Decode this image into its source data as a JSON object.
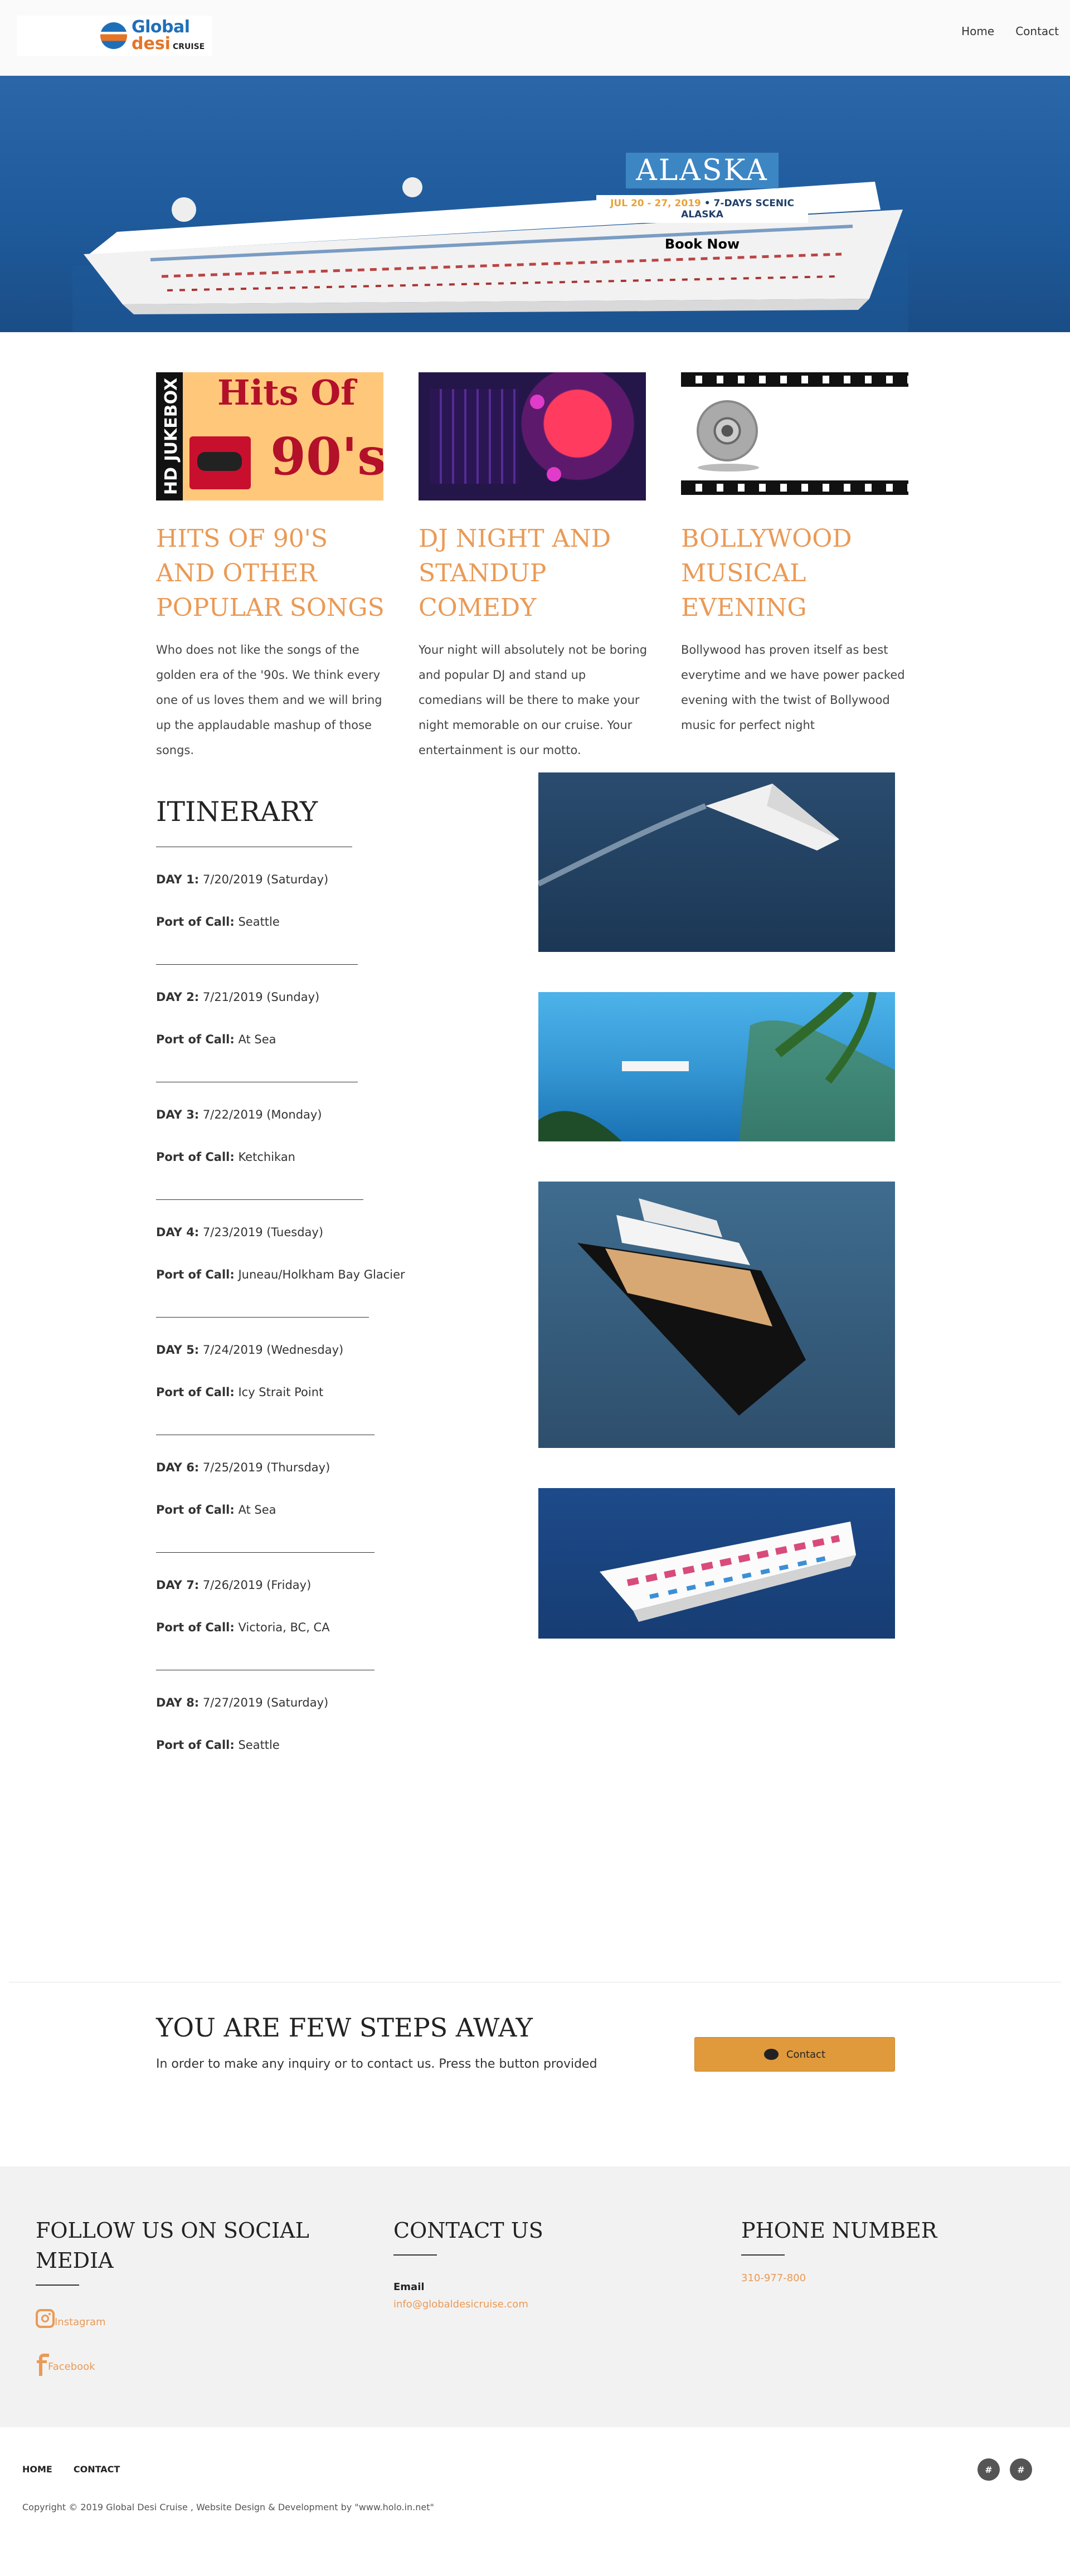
{
  "header": {
    "logo": {
      "global": "Global",
      "desi": "desi",
      "cruise": "CRUISE"
    },
    "nav": [
      "Home",
      "Contact"
    ]
  },
  "hero": {
    "title": "ALASKA",
    "dates": "JUL 20 - 27, 2019",
    "dates_extra": " • 7-DAYS SCENIC ALASKA",
    "book_label": "Book Now"
  },
  "features": [
    {
      "title": "HITS OF 90'S AND OTHER POPULAR SONGS",
      "text": "Who does not like the songs of the golden era of the '90s. We think every one of us loves them and we will bring up the applaudable mashup of those songs.",
      "image": {
        "side": "HD JUKEBOX",
        "top": "Hits Of",
        "big": "90's"
      }
    },
    {
      "title": "DJ NIGHT AND STANDUP COMEDY",
      "text": "Your night will absolutely not be boring and popular DJ and stand up comedians will be there to make your night memorable on our cruise. Your entertainment is our motto."
    },
    {
      "title": "BOLLYWOOD MUSICAL EVENING",
      "text": "Bollywood has proven itself as best everytime and we have power packed evening with the twist of Bollywood music for perfect night"
    }
  ],
  "itinerary": {
    "title": "ITINERARY",
    "port_label": "Port of Call:",
    "days": [
      {
        "label": "DAY 1:",
        "date": " 7/20/2019 (Saturday)",
        "port": " Seattle"
      },
      {
        "label": "DAY 2:",
        "date": " 7/21/2019 (Sunday)",
        "port": " At Sea"
      },
      {
        "label": "DAY 3:",
        "date": " 7/22/2019 (Monday)",
        "port": " Ketchikan"
      },
      {
        "label": "DAY 4:",
        "date": " 7/23/2019 (Tuesday)",
        "port": " Juneau/Holkham Bay Glacier"
      },
      {
        "label": "DAY 5:",
        "date": " 7/24/2019 (Wednesday)",
        "port": " Icy Strait Point"
      },
      {
        "label": "DAY 6:",
        "date": " 7/25/2019 (Thursday)",
        "port": " At Sea"
      },
      {
        "label": "DAY 7:",
        "date": " 7/26/2019 (Friday)",
        "port": " Victoria, BC, CA"
      },
      {
        "label": "DAY 8:",
        "date": " 7/27/2019 (Saturday)",
        "port": " Seattle"
      }
    ]
  },
  "cta": {
    "title": "YOU ARE FEW STEPS AWAY",
    "text": "In order to make any inquiry or to contact us. Press the button provided",
    "button": "Contact"
  },
  "footer": {
    "social_title": "FOLLOW US ON SOCIAL MEDIA",
    "instagram": "Instagram",
    "facebook": "Facebook",
    "contact_title": "CONTACT US",
    "email_label": "Email",
    "email": "info@globaldesicruise.com",
    "phone_title": "PHONE NUMBER",
    "phone": "310-977-800",
    "nav": [
      "HOME",
      "CONTACT"
    ],
    "copyright": "Copyright © 2019 Global Desi Cruise , Website Design & Development by \"www.holo.in.net\"",
    "social_buttons": [
      "#",
      "#"
    ]
  },
  "colors": {
    "accent": "#ea9a56",
    "button": "#e09a3b",
    "sea": "#1f5b9c",
    "footer_bg": "#f2f2f2"
  }
}
